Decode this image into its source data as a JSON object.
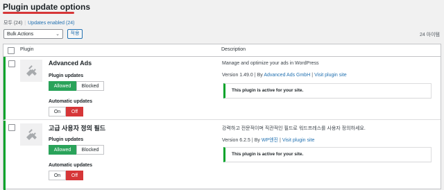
{
  "page": {
    "title": "Plugin update options"
  },
  "filters": {
    "all_label": "모두",
    "all_count": "(24)",
    "enabled_label": "Updates enabled",
    "enabled_count": "(24)"
  },
  "toolbar": {
    "bulk_actions": "Bulk Actions",
    "apply_label": "적용",
    "item_count": "24 아이템"
  },
  "table": {
    "col_plugin": "Plugin",
    "col_description": "Description"
  },
  "plugins": [
    {
      "name": "Advanced Ads",
      "plugin_updates_label": "Plugin updates",
      "allowed_label": "Allowed",
      "blocked_label": "Blocked",
      "automatic_updates_label": "Automatic updates",
      "on_label": "On",
      "off_label": "Off",
      "description": "Manage and optimize your ads in WordPress",
      "version": "Version 1.49.0",
      "by_label": "By",
      "author": "Advanced Ads GmbH",
      "visit_label": "Visit plugin site",
      "notice": "This plugin is active for your site."
    },
    {
      "name": "고급 사용자 정의 필드",
      "plugin_updates_label": "Plugin updates",
      "allowed_label": "Allowed",
      "blocked_label": "Blocked",
      "automatic_updates_label": "Automatic updates",
      "on_label": "On",
      "off_label": "Off",
      "description": "강력하고 전문적이며 직관적인 필드로 워드프레스를 사용자 정의하세요.",
      "version": "Version 6.2.5",
      "by_label": "By",
      "author": "WP엔진",
      "visit_label": "Visit plugin site",
      "notice": "This plugin is active for your site."
    }
  ],
  "colors": {
    "accent": "#2271b1",
    "active": "#00a32a",
    "allowed": "#2aa35a",
    "off": "#d63638"
  }
}
